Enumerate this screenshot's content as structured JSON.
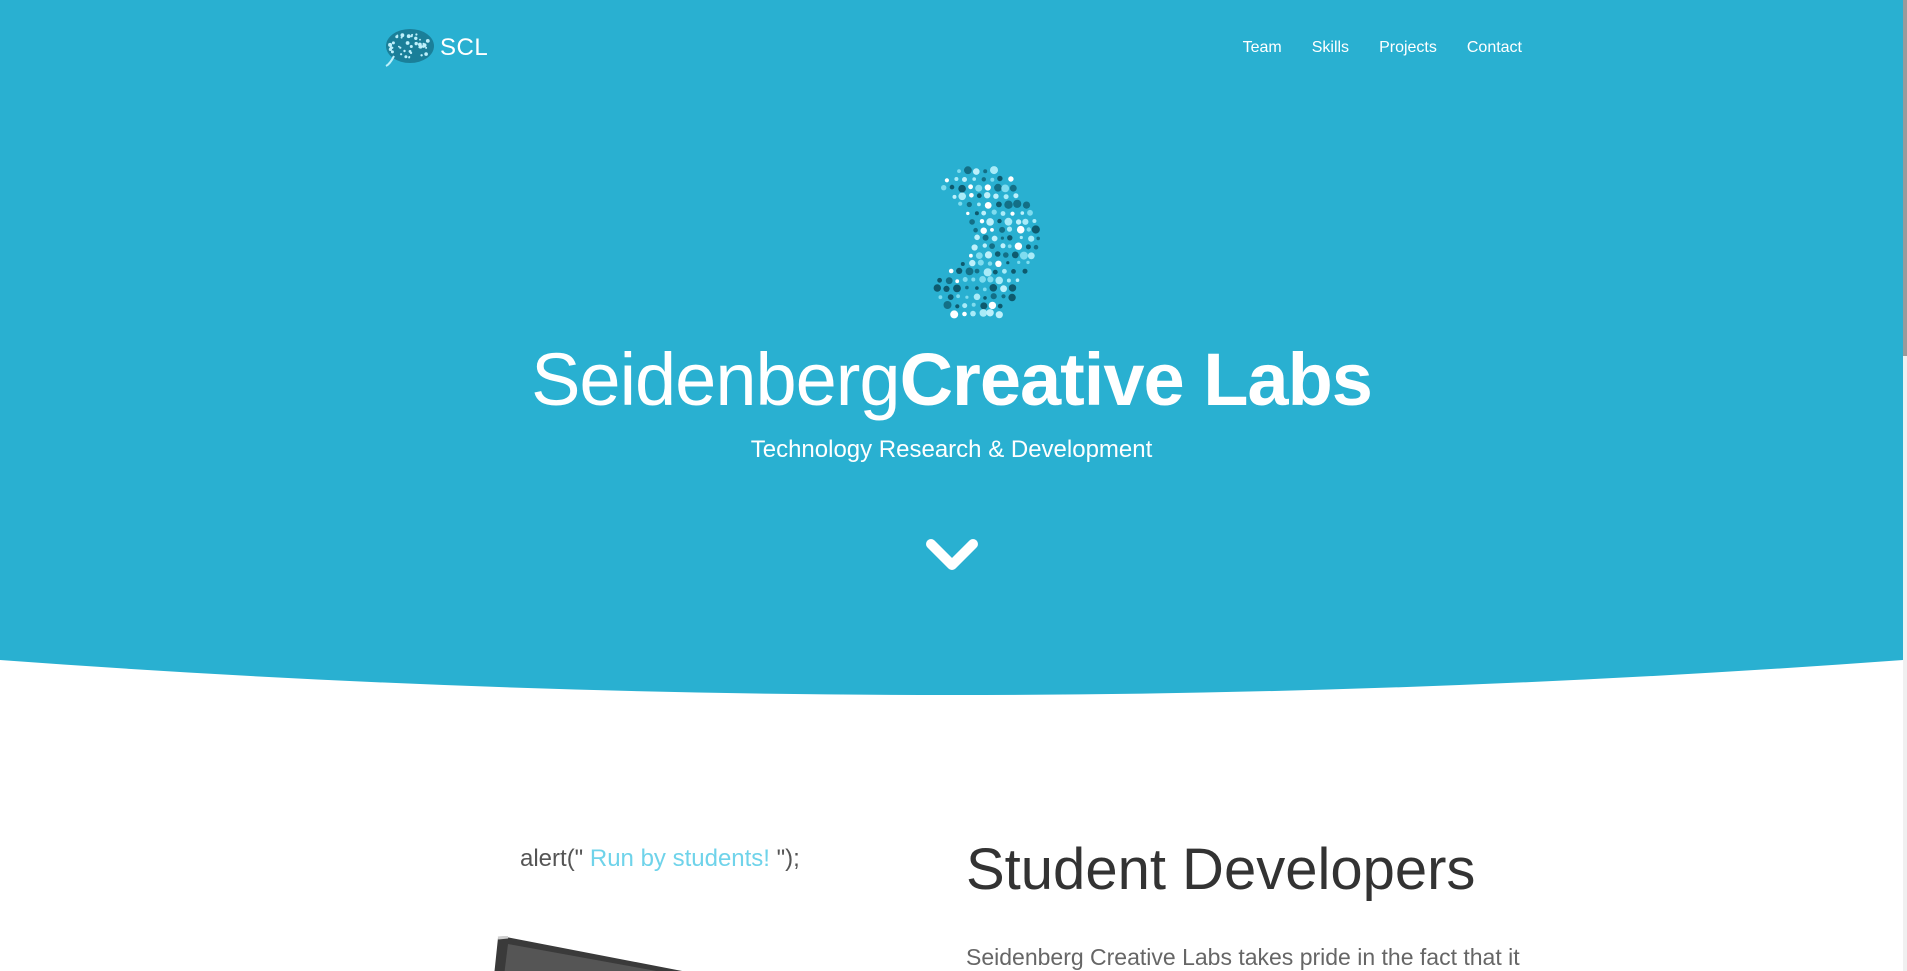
{
  "colors": {
    "hero_background": "#29b0d1",
    "accent_text": "#6fd3ea",
    "heading_text": "#333333",
    "body_text": "#666666"
  },
  "navbar": {
    "brand_text": "SCL",
    "brand_icon": "brain-icon",
    "links": [
      {
        "label": "Team"
      },
      {
        "label": "Skills"
      },
      {
        "label": "Projects"
      },
      {
        "label": "Contact"
      }
    ]
  },
  "hero": {
    "logo_icon": "dotted-brain-icon",
    "title_light": "Seidenberg",
    "title_bold": "Creative Labs",
    "subtitle": "Technology Research & Development",
    "scroll_icon": "chevron-down-icon"
  },
  "about": {
    "code_prefix": "alert(\"",
    "code_highlight": " Run by students! ",
    "code_suffix": "\");",
    "heading": "Student Developers",
    "text": "Seidenberg Creative Labs takes pride in the fact that it"
  }
}
